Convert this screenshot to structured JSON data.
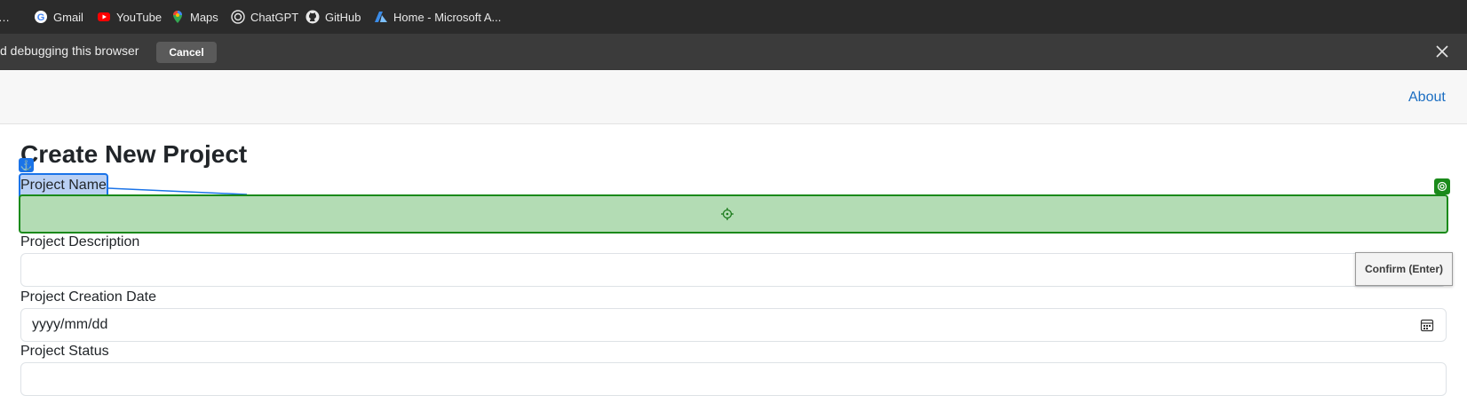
{
  "bookmarks": [
    {
      "label": "…",
      "icon": "bookmark-truncated-icon"
    },
    {
      "label": "Gmail",
      "icon": "google-icon"
    },
    {
      "label": "YouTube",
      "icon": "youtube-icon"
    },
    {
      "label": "Maps",
      "icon": "maps-icon"
    },
    {
      "label": "ChatGPT",
      "icon": "chatgpt-icon"
    },
    {
      "label": "GitHub",
      "icon": "github-icon"
    },
    {
      "label": "Home - Microsoft A...",
      "icon": "azure-icon"
    }
  ],
  "infobar": {
    "message": "d debugging this browser",
    "cancel_label": "Cancel"
  },
  "navbar": {
    "about_label": "About"
  },
  "form": {
    "title": "Create New Project",
    "name_label": "Project Name",
    "description_label": "Project Description",
    "creation_date_label": "Project Creation Date",
    "creation_date_value": "yyyy/mm/dd",
    "status_label": "Project Status"
  },
  "overlay": {
    "confirm_label": "Confirm (Enter)",
    "anchor_glyph": "⚓"
  },
  "colors": {
    "bookmarks_bg": "#2b2b2b",
    "infobar_bg": "#3b3b3b",
    "accent_blue": "#1a73e8",
    "target_green": "#1a8a1a",
    "link_blue": "#1b6ec2"
  }
}
